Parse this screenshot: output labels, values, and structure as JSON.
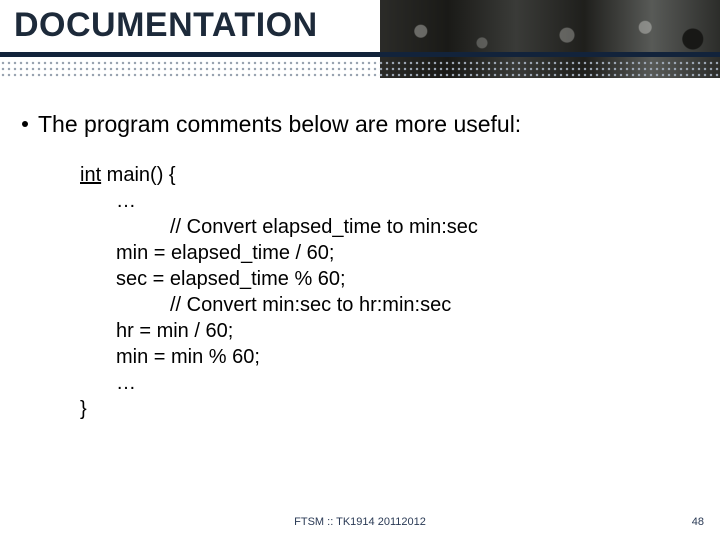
{
  "header": {
    "title": "DOCUMENTATION"
  },
  "bullet": {
    "text": "The program comments below are more useful:"
  },
  "code": {
    "sig_kw": "int",
    "sig_rest": " main() {",
    "ellipsis1": "…",
    "c1": "// Convert elapsed_time to min:sec",
    "s1": "min = elapsed_time / 60;",
    "s2": "sec = elapsed_time % 60;",
    "c2": "// Convert min:sec to hr:min:sec",
    "s3": "hr = min / 60;",
    "s4": "min = min % 60;",
    "ellipsis2": "…",
    "close": "}"
  },
  "footer": {
    "center": "FTSM :: TK1914 20112012",
    "page": "48"
  }
}
